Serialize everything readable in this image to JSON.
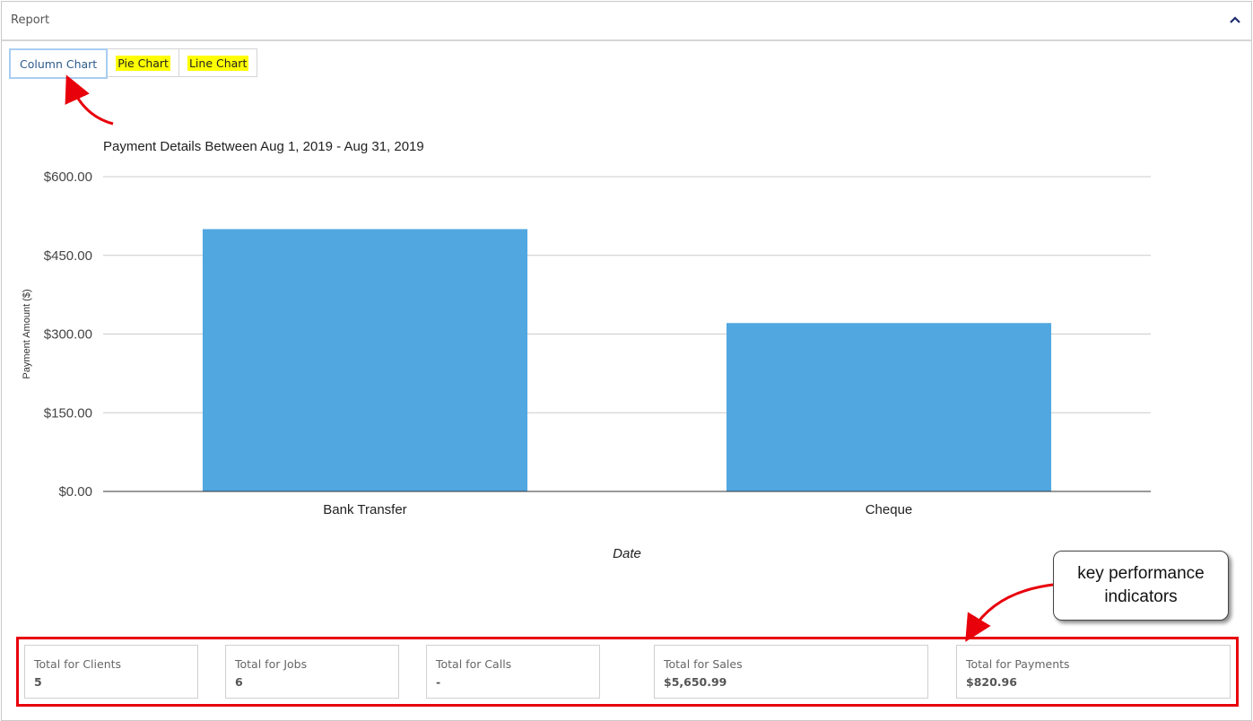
{
  "panel": {
    "title": "Report",
    "collapse_icon": "chevron-up-icon"
  },
  "tabs": [
    {
      "label": "Column Chart",
      "active": true,
      "highlighted": false
    },
    {
      "label": "Pie Chart",
      "active": false,
      "highlighted": true
    },
    {
      "label": "Line Chart",
      "active": false,
      "highlighted": true
    }
  ],
  "colors": {
    "bar": "#51a7e0",
    "highlight": "#ffff00",
    "annotation": "#e8000b",
    "active_tab_border": "#a9cdf2"
  },
  "chart_data": {
    "type": "bar",
    "title": "Payment Details Between Aug 1, 2019 - Aug 31, 2019",
    "xlabel": "Date",
    "ylabel": "Payment Amount ($)",
    "categories": [
      "Bank Transfer",
      "Cheque"
    ],
    "values": [
      500.0,
      320.96
    ],
    "ylim": [
      0,
      600
    ],
    "yticks": [
      0,
      150,
      300,
      450,
      600
    ],
    "ytick_labels": [
      "$0.00",
      "$150.00",
      "$300.00",
      "$450.00",
      "$600.00"
    ],
    "grid": true,
    "legend": "none"
  },
  "kpis": [
    {
      "label": "Total for Clients",
      "value": "5"
    },
    {
      "label": "Total for Jobs",
      "value": "6"
    },
    {
      "label": "Total for Calls",
      "value": "-"
    },
    {
      "label": "Total for Sales",
      "value": "$5,650.99"
    },
    {
      "label": "Total for Payments",
      "value": "$820.96"
    }
  ],
  "annotations": {
    "callout_text": "key performance indicators"
  }
}
